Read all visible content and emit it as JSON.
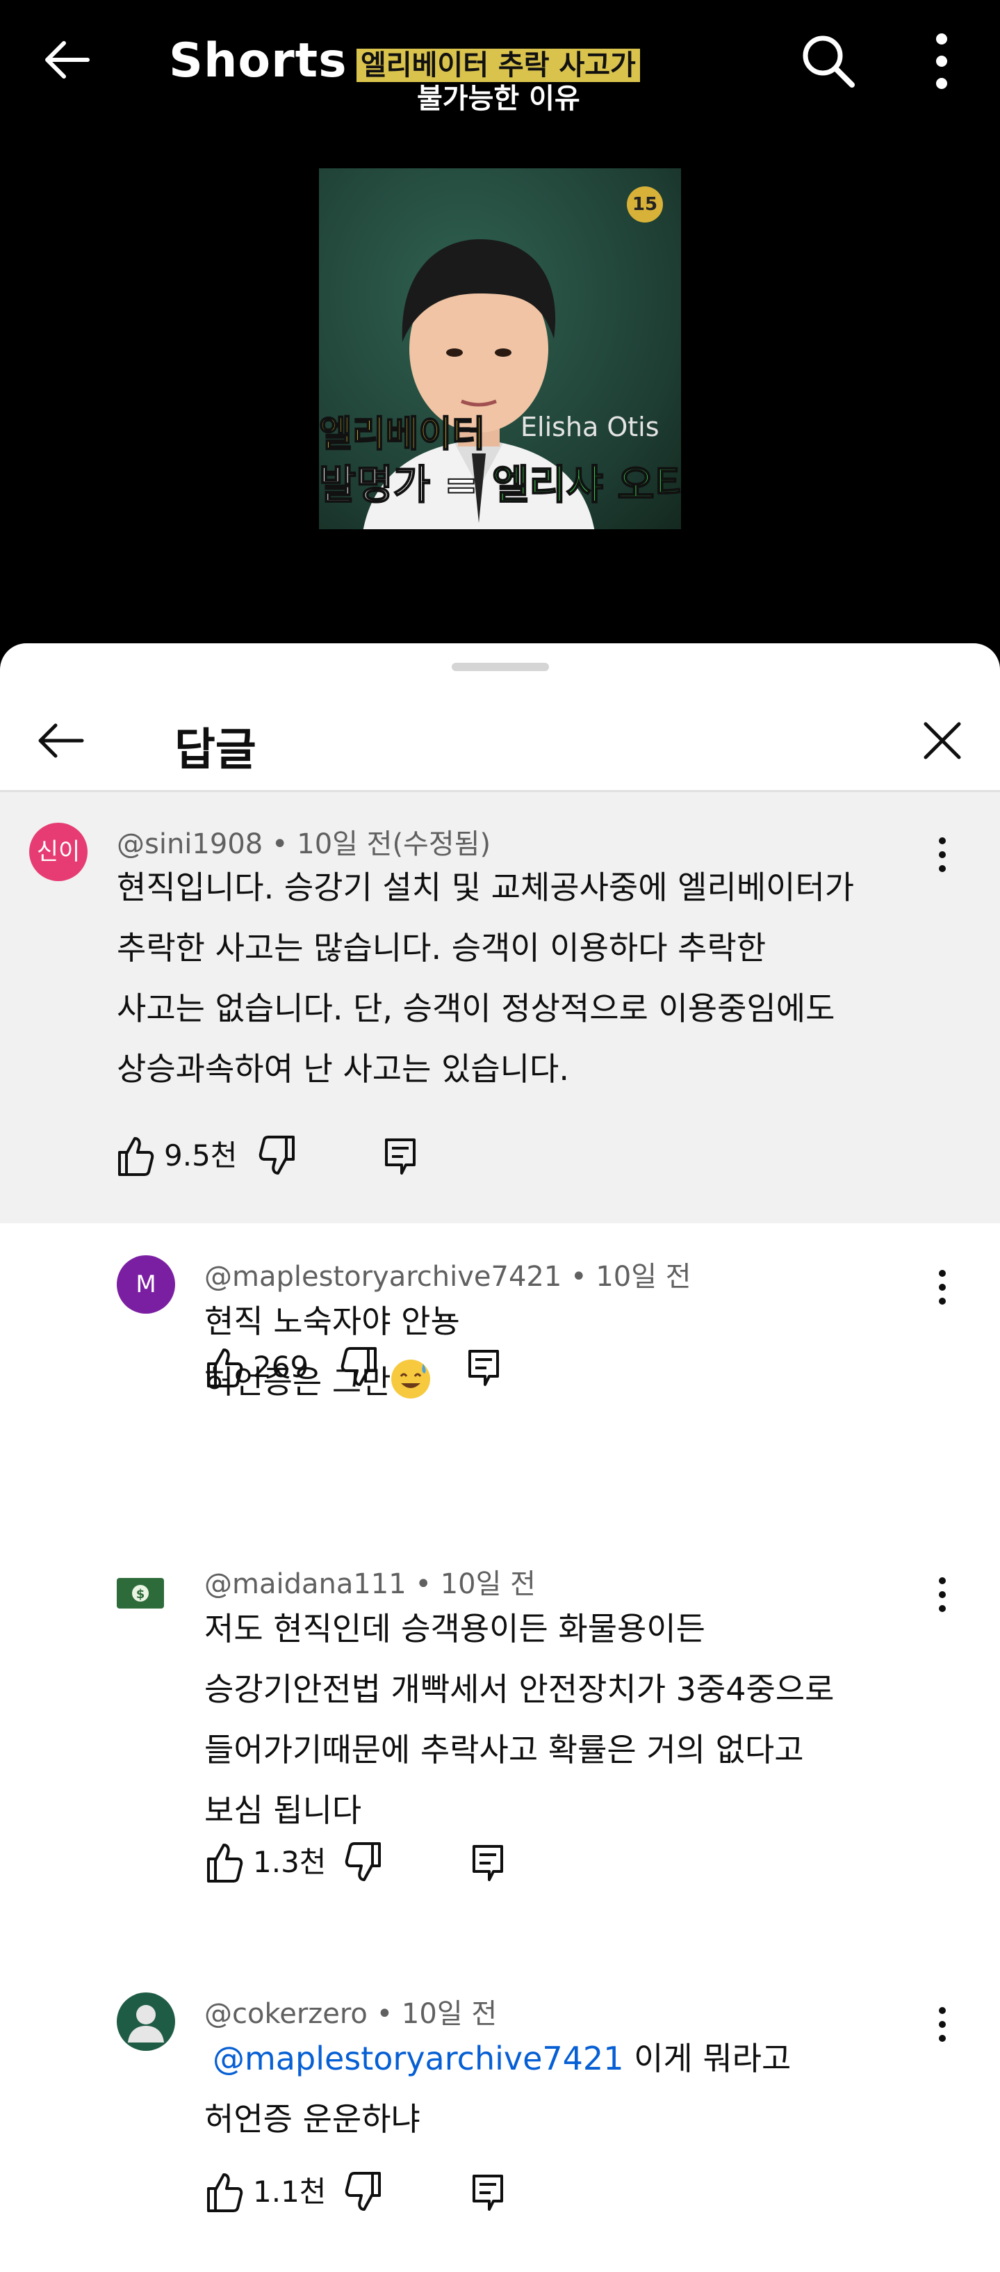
{
  "app": {
    "title": "Shorts"
  },
  "video": {
    "headline_line1": "엘리베이터 추락 사고가",
    "headline_line2": "불가능한 이유",
    "badge": "15",
    "name_en": "Elisha Otis",
    "caption_line1": "엘리베이터",
    "caption_line2_prefix": "발명가 ",
    "caption_line2_eq": "=",
    "caption_line2_name": " 엘리샤 오티스"
  },
  "sheet": {
    "title": "답글"
  },
  "comments": [
    {
      "avatar_text": "신이",
      "avatar_color": "#e63c73",
      "meta": "@sini1908 • 10일 전(수정됨)",
      "lines": [
        "현직입니다. 승강기 설치 및 교체공사중에 엘리베이터가",
        "추락한 사고는 많습니다. 승객이 이용하다 추락한",
        "사고는 없습니다. 단, 승객이 정상적으로 이용중임에도",
        "상승과속하여 난 사고는 있습니다."
      ],
      "likes": "9.5천"
    },
    {
      "avatar_text": "M",
      "avatar_color": "#7b1fa2",
      "meta": "@maplestoryarchive7421 • 10일 전",
      "lines": [
        "현직 노숙자야 안뇽",
        "허언증은 그만"
      ],
      "likes": "269"
    },
    {
      "avatar_icon": "money-icon",
      "meta": "@maidana111 • 10일 전",
      "lines": [
        "저도 현직인데 승객용이든 화물용이든",
        "승강기안전법 개빡세서 안전장치가 3중4중으로",
        "들어가기때문에 추락사고 확률은 거의 없다고",
        "보심 됩니다"
      ],
      "likes": "1.3천"
    },
    {
      "avatar_icon": "default-avatar-icon",
      "avatar_color": "#1f5c45",
      "meta": "@cokerzero • 10일 전",
      "mention": "@maplestoryarchive7421",
      "line1_rest": " 이게 뭐라고",
      "line2": "허언증 운운하냐",
      "likes": "1.1천"
    }
  ]
}
